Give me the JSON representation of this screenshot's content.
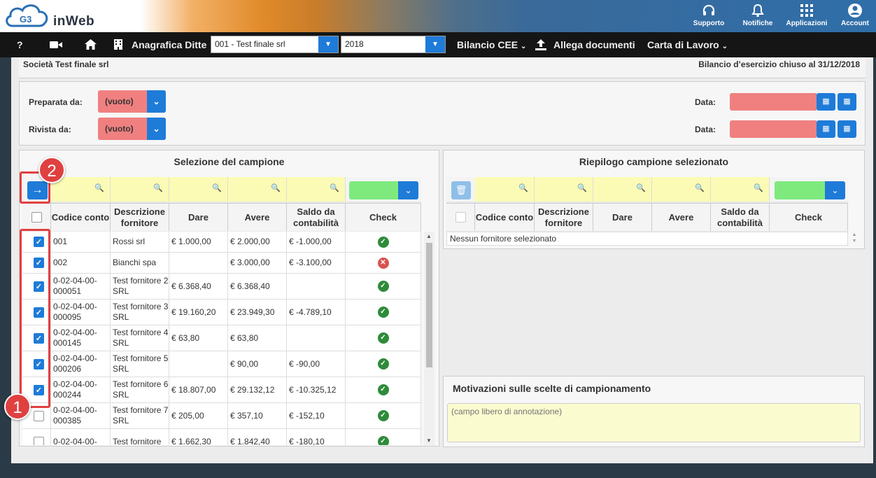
{
  "app": {
    "brand": "inWeb",
    "logo_text": "G3"
  },
  "topnav": [
    {
      "label": "Supporto",
      "icon": "headset-icon"
    },
    {
      "label": "Notifiche",
      "icon": "bell-icon"
    },
    {
      "label": "Applicazioni",
      "icon": "grid-icon"
    },
    {
      "label": "Account",
      "icon": "user-icon"
    }
  ],
  "menubar": {
    "help": "?",
    "anagrafica": "Anagrafica Ditte",
    "company_select": "001 - Test finale srl",
    "year_select": "2018",
    "bilancio": "Bilancio CEE",
    "allega": "Allega documenti",
    "carta": "Carta di Lavoro"
  },
  "header": {
    "company": "Società Test finale srl",
    "closing": "Bilancio d’esercizio chiuso al 31/12/2018"
  },
  "prep": {
    "preparata_label": "Preparata da:",
    "rivista_label": "Rivista da:",
    "preparata_value": "(vuoto)",
    "rivista_value": "(vuoto)",
    "data_label": "Data:"
  },
  "selezione": {
    "title": "Selezione del campione",
    "columns": [
      "Codice conto",
      "Descrizione fornitore",
      "Dare",
      "Avere",
      "Saldo da contabilità",
      "Check"
    ],
    "rows": [
      {
        "checked": true,
        "codice": "001",
        "descr": "Rossi srl",
        "dare": "€ 1.000,00",
        "avere": "€ 2.000,00",
        "saldo": "€ -1.000,00",
        "check": "ok"
      },
      {
        "checked": true,
        "codice": "002",
        "descr": "Bianchi spa",
        "dare": "",
        "avere": "€ 3.000,00",
        "saldo": "€ -3.100,00",
        "check": "ko"
      },
      {
        "checked": true,
        "codice": "0-02-04-00-000051",
        "descr": "Test fornitore 2 SRL",
        "dare": "€ 6.368,40",
        "avere": "€ 6.368,40",
        "saldo": "",
        "check": "ok"
      },
      {
        "checked": true,
        "codice": "0-02-04-00-000095",
        "descr": "Test fornitore 3 SRL",
        "dare": "€ 19.160,20",
        "avere": "€ 23.949,30",
        "saldo": "€ -4.789,10",
        "check": "ok"
      },
      {
        "checked": true,
        "codice": "0-02-04-00-000145",
        "descr": "Test fornitore 4 SRL",
        "dare": "€ 63,80",
        "avere": "€ 63,80",
        "saldo": "",
        "check": "ok"
      },
      {
        "checked": true,
        "codice": "0-02-04-00-000206",
        "descr": "Test fornitore 5 SRL",
        "dare": "",
        "avere": "€ 90,00",
        "saldo": "€ -90,00",
        "check": "ok"
      },
      {
        "checked": true,
        "codice": "0-02-04-00-000244",
        "descr": "Test fornitore 6 SRL",
        "dare": "€ 18.807,00",
        "avere": "€ 29.132,12",
        "saldo": "€ -10.325,12",
        "check": "ok"
      },
      {
        "checked": false,
        "codice": "0-02-04-00-000385",
        "descr": "Test fornitore 7 SRL",
        "dare": "€ 205,00",
        "avere": "€ 357,10",
        "saldo": "€ -152,10",
        "check": "ok"
      },
      {
        "checked": false,
        "codice": "0-02-04-00-",
        "descr": "Test fornitore",
        "dare": "€ 1.662,30",
        "avere": "€ 1.842,40",
        "saldo": "€ -180,10",
        "check": "ok"
      }
    ]
  },
  "riepilogo": {
    "title": "Riepilogo campione selezionato",
    "columns": [
      "Codice conto",
      "Descrizione fornitore",
      "Dare",
      "Avere",
      "Saldo da contabilità",
      "Check"
    ],
    "empty": "Nessun fornitore selezionato"
  },
  "motivazioni": {
    "title": "Motivazioni sulle scelte di campionamento",
    "placeholder": "(campo libero di annotazione)"
  },
  "callouts": {
    "one": "1",
    "two": "2"
  },
  "colors": {
    "accent": "#1e7bd8",
    "empty_field": "#f08080",
    "filter_bg": "#fbfbb5",
    "check_ok": "#2e8b3a",
    "check_ko": "#d9534f",
    "callout": "#e04040"
  }
}
